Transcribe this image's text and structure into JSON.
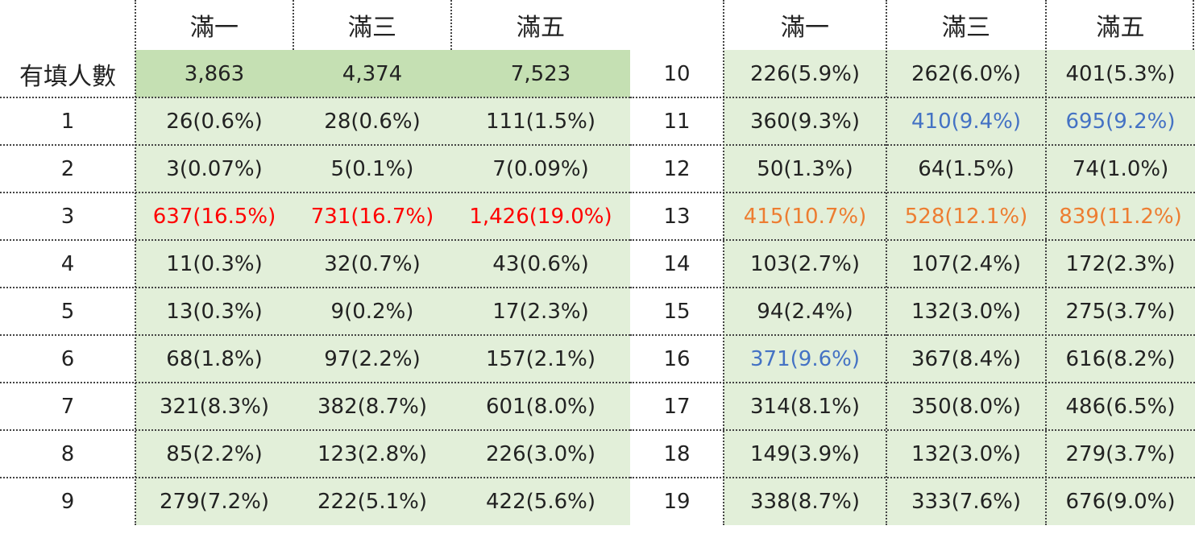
{
  "left_table": {
    "headers": [
      "滿一",
      "滿三",
      "滿五"
    ],
    "total_label": "有填人數",
    "totals": [
      "3,863",
      "4,374",
      "7,523"
    ],
    "rows": [
      {
        "label": "1",
        "values": [
          "26(0.6%)",
          "28(0.6%)",
          "111(1.5%)"
        ],
        "colors": [
          "",
          "",
          ""
        ]
      },
      {
        "label": "2",
        "values": [
          "3(0.07%)",
          "5(0.1%)",
          "7(0.09%)"
        ],
        "colors": [
          "",
          "",
          ""
        ]
      },
      {
        "label": "3",
        "values": [
          "637(16.5%)",
          "731(16.7%)",
          "1,426(19.0%)"
        ],
        "colors": [
          "red",
          "red",
          "red"
        ]
      },
      {
        "label": "4",
        "values": [
          "11(0.3%)",
          "32(0.7%)",
          "43(0.6%)"
        ],
        "colors": [
          "",
          "",
          ""
        ]
      },
      {
        "label": "5",
        "values": [
          "13(0.3%)",
          "9(0.2%)",
          "17(2.3%)"
        ],
        "colors": [
          "",
          "",
          ""
        ]
      },
      {
        "label": "6",
        "values": [
          "68(1.8%)",
          "97(2.2%)",
          "157(2.1%)"
        ],
        "colors": [
          "",
          "",
          ""
        ]
      },
      {
        "label": "7",
        "values": [
          "321(8.3%)",
          "382(8.7%)",
          "601(8.0%)"
        ],
        "colors": [
          "",
          "",
          ""
        ]
      },
      {
        "label": "8",
        "values": [
          "85(2.2%)",
          "123(2.8%)",
          "226(3.0%)"
        ],
        "colors": [
          "",
          "",
          ""
        ]
      },
      {
        "label": "9",
        "values": [
          "279(7.2%)",
          "222(5.1%)",
          "422(5.6%)"
        ],
        "colors": [
          "",
          "",
          ""
        ]
      }
    ]
  },
  "right_table": {
    "headers": [
      "滿一",
      "滿三",
      "滿五"
    ],
    "rows": [
      {
        "label": "10",
        "values": [
          "226(5.9%)",
          "262(6.0%)",
          "401(5.3%)"
        ],
        "colors": [
          "",
          "",
          ""
        ]
      },
      {
        "label": "11",
        "values": [
          "360(9.3%)",
          "410(9.4%)",
          "695(9.2%)"
        ],
        "colors": [
          "",
          "blue",
          "blue"
        ]
      },
      {
        "label": "12",
        "values": [
          "50(1.3%)",
          "64(1.5%)",
          "74(1.0%)"
        ],
        "colors": [
          "",
          "",
          ""
        ]
      },
      {
        "label": "13",
        "values": [
          "415(10.7%)",
          "528(12.1%)",
          "839(11.2%)"
        ],
        "colors": [
          "orange",
          "orange",
          "orange"
        ]
      },
      {
        "label": "14",
        "values": [
          "103(2.7%)",
          "107(2.4%)",
          "172(2.3%)"
        ],
        "colors": [
          "",
          "",
          ""
        ]
      },
      {
        "label": "15",
        "values": [
          "94(2.4%)",
          "132(3.0%)",
          "275(3.7%)"
        ],
        "colors": [
          "",
          "",
          ""
        ]
      },
      {
        "label": "16",
        "values": [
          "371(9.6%)",
          "367(8.4%)",
          "616(8.2%)"
        ],
        "colors": [
          "blue",
          "",
          ""
        ]
      },
      {
        "label": "17",
        "values": [
          "314(8.1%)",
          "350(8.0%)",
          "486(6.5%)"
        ],
        "colors": [
          "",
          "",
          ""
        ]
      },
      {
        "label": "18",
        "values": [
          "149(3.9%)",
          "132(3.0%)",
          "279(3.7%)"
        ],
        "colors": [
          "",
          "",
          ""
        ]
      },
      {
        "label": "19",
        "values": [
          "338(8.7%)",
          "333(7.6%)",
          "676(9.0%)"
        ],
        "colors": [
          "",
          "",
          ""
        ]
      }
    ]
  },
  "colors": {
    "red": "#ff0000",
    "orange": "#ed7d31",
    "blue": "#4472c4",
    "fill_light": "#e2efd9",
    "fill_dark": "#c5e0b3"
  }
}
